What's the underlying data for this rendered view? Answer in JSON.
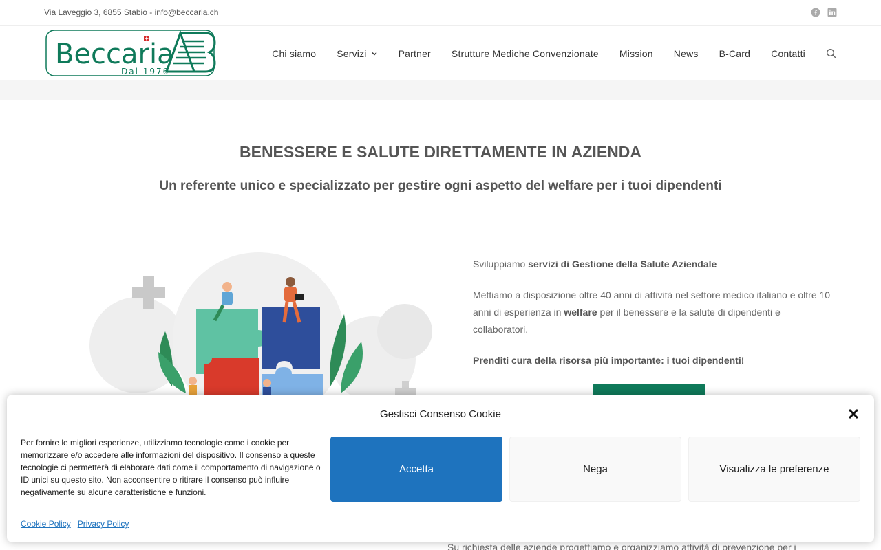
{
  "topbar": {
    "info": "Via Laveggio 3, 6855 Stabio - info@beccaria.ch",
    "social_icons": [
      "facebook-icon",
      "linkedin-icon"
    ]
  },
  "logo": {
    "brand": "Beccaria",
    "since": "Dal 1976"
  },
  "nav": {
    "items": [
      "Chi siamo",
      "Servizi",
      "Partner",
      "Strutture Mediche Convenzionate",
      "Mission",
      "News",
      "B-Card",
      "Contatti"
    ]
  },
  "hero": {
    "title": "BENESSERE E SALUTE DIRETTAMENTE IN AZIENDA",
    "subtitle": "Un referente unico e specializzato per gestire ogni aspetto del welfare per i tuoi dipendenti"
  },
  "copy": {
    "p1_pre": "Sviluppiamo ",
    "p1_bold": "servizi di Gestione della Salute Aziendale",
    "p2_pre": "Mettiamo a disposizione oltre 40 anni di attività nel settore medico italiano e oltre 10 anni di esperienza in ",
    "p2_bold": "welfare",
    "p2_post": " per il benessere e la salute di dipendenti e collaboratori.",
    "p3_bold": "Prenditi cura della risorsa più importante: i tuoi dipendenti!"
  },
  "bottom_text": "Su richiesta delle aziende progettiamo e organizziamo attività di prevenzione per i",
  "cookie": {
    "title": "Gestisci Consenso Cookie",
    "message": "Per fornire le migliori esperienze, utilizziamo tecnologie come i cookie per memorizzare e/o accedere alle informazioni del dispositivo. Il consenso a queste tecnologie ci permetterà di elaborare dati come il comportamento di navigazione o ID unici su questo sito. Non acconsentire o ritirare il consenso può influire negativamente su alcune caratteristiche e funzioni.",
    "accept": "Accetta",
    "deny": "Nega",
    "prefs": "Visualizza le preferenze",
    "links": [
      "Cookie Policy",
      "Privacy Policy"
    ]
  },
  "colors": {
    "brand_green": "#0f7a5a",
    "accept_blue": "#1e73be"
  }
}
